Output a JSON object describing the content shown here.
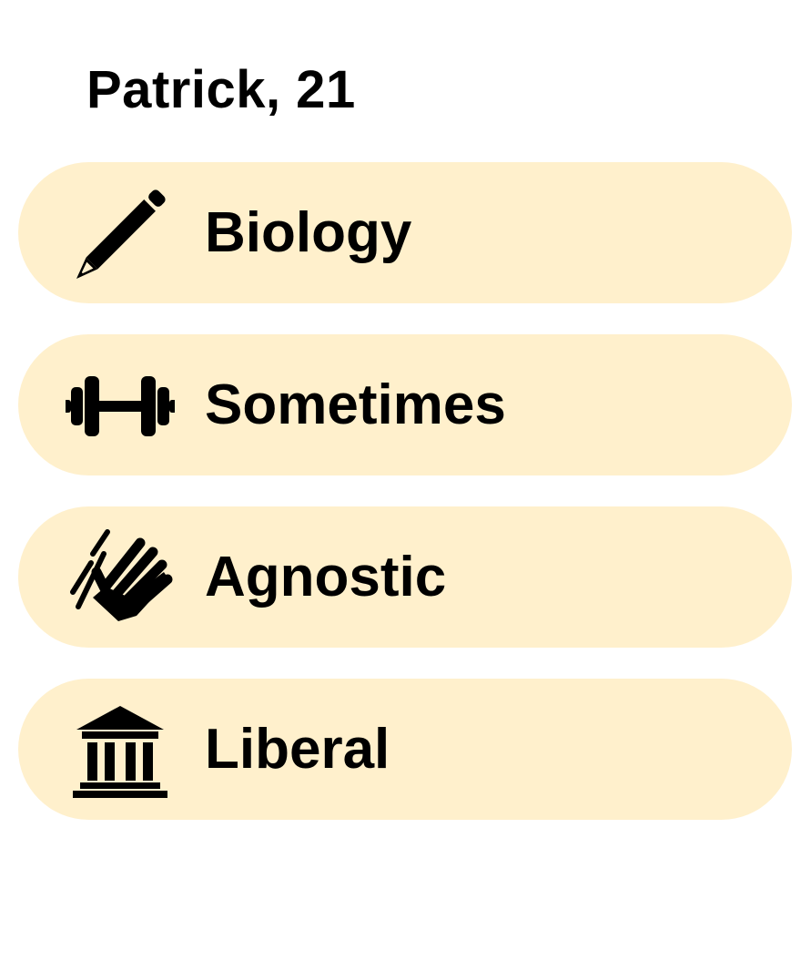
{
  "profile": {
    "name_age": "Patrick, 21"
  },
  "theme": {
    "pill_background": "#fff0cc",
    "text_color": "#000000"
  },
  "attributes": [
    {
      "icon": "pencil-icon",
      "label": "Biology"
    },
    {
      "icon": "dumbbell-icon",
      "label": "Sometimes"
    },
    {
      "icon": "praying-hands-icon",
      "label": "Agnostic"
    },
    {
      "icon": "government-building-icon",
      "label": "Liberal"
    }
  ]
}
